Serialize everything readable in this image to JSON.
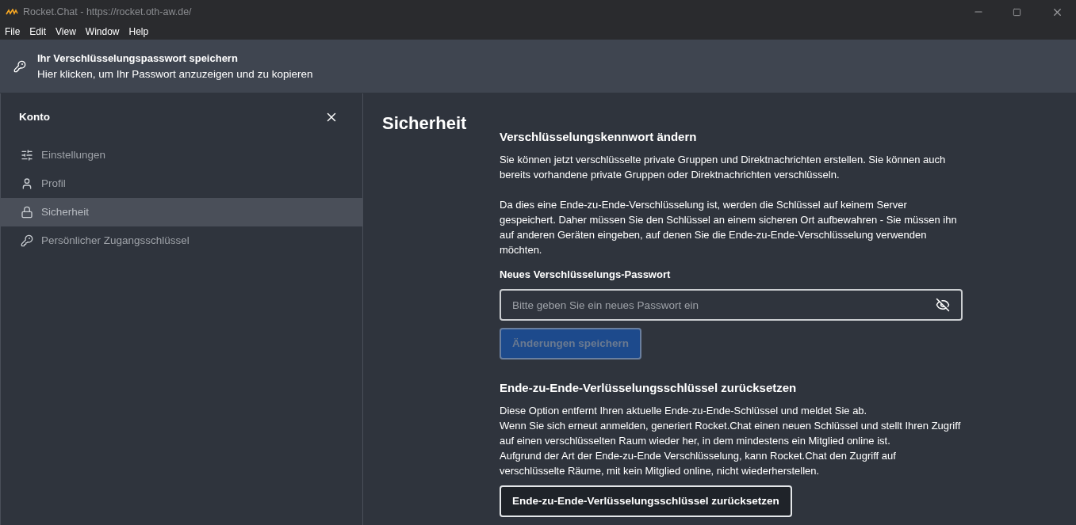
{
  "window": {
    "title": "Rocket.Chat - https://rocket.oth-aw.de/"
  },
  "menu": [
    "File",
    "Edit",
    "View",
    "Window",
    "Help"
  ],
  "banner": {
    "title": "Ihr Verschlüsselungspasswort speichern",
    "text": "Hier klicken, um Ihr Passwort anzuzeigen und zu kopieren"
  },
  "sidebar": {
    "title": "Konto",
    "items": [
      {
        "label": "Einstellungen",
        "kind": "sliders",
        "selected": false
      },
      {
        "label": "Profil",
        "kind": "user",
        "selected": false
      },
      {
        "label": "Sicherheit",
        "kind": "lock",
        "selected": true
      },
      {
        "label": "Persönlicher Zugangsschlüssel",
        "kind": "key",
        "selected": false
      }
    ]
  },
  "page": {
    "title": "Sicherheit",
    "change": {
      "heading": "Verschlüsselungskennwort ändern",
      "paragraphs": [
        "Sie können jetzt verschlüsselte private Gruppen und Direktnachrichten erstellen. Sie können auch bereits vorhandene private Gruppen oder Direktnachrichten verschlüsseln.",
        "Da dies eine Ende-zu-Ende-Verschlüsselung ist, werden die Schlüssel auf keinem Server gespeichert. Daher müssen Sie den Schlüssel an einem sicheren Ort aufbewahren - Sie müssen ihn auf anderen Geräten eingeben, auf denen Sie die Ende-zu-Ende-Verschlüsselung verwenden möchten."
      ],
      "field_label": "Neues Verschlüsselungs-Passwort",
      "placeholder": "Bitte geben Sie ein neues Passwort ein",
      "button": {
        "label": "Änderungen speichern",
        "disabled": true
      }
    },
    "reset": {
      "heading": "Ende-zu-Ende-Verlüsselungsschlüssel zurücksetzen",
      "lines": [
        "Diese Option entfernt Ihren aktuelle Ende-zu-Ende-Schlüssel und meldet Sie ab.",
        "Wenn Sie sich erneut anmelden, generiert Rocket.Chat einen neuen Schlüssel und stellt Ihren Zugriff auf einen verschlüsselten Raum wieder her, in dem mindestens ein Mitglied online ist.",
        "Aufgrund der Art der Ende-zu-Ende Verschlüsselung, kann Rocket.Chat den Zugriff auf verschlüsselte Räume, mit kein Mitglied online, nicht wiederherstellen."
      ],
      "button": {
        "label": "Ende-zu-Ende-Verlüsselungsschlüssel zurücksetzen",
        "disabled": false
      }
    }
  }
}
